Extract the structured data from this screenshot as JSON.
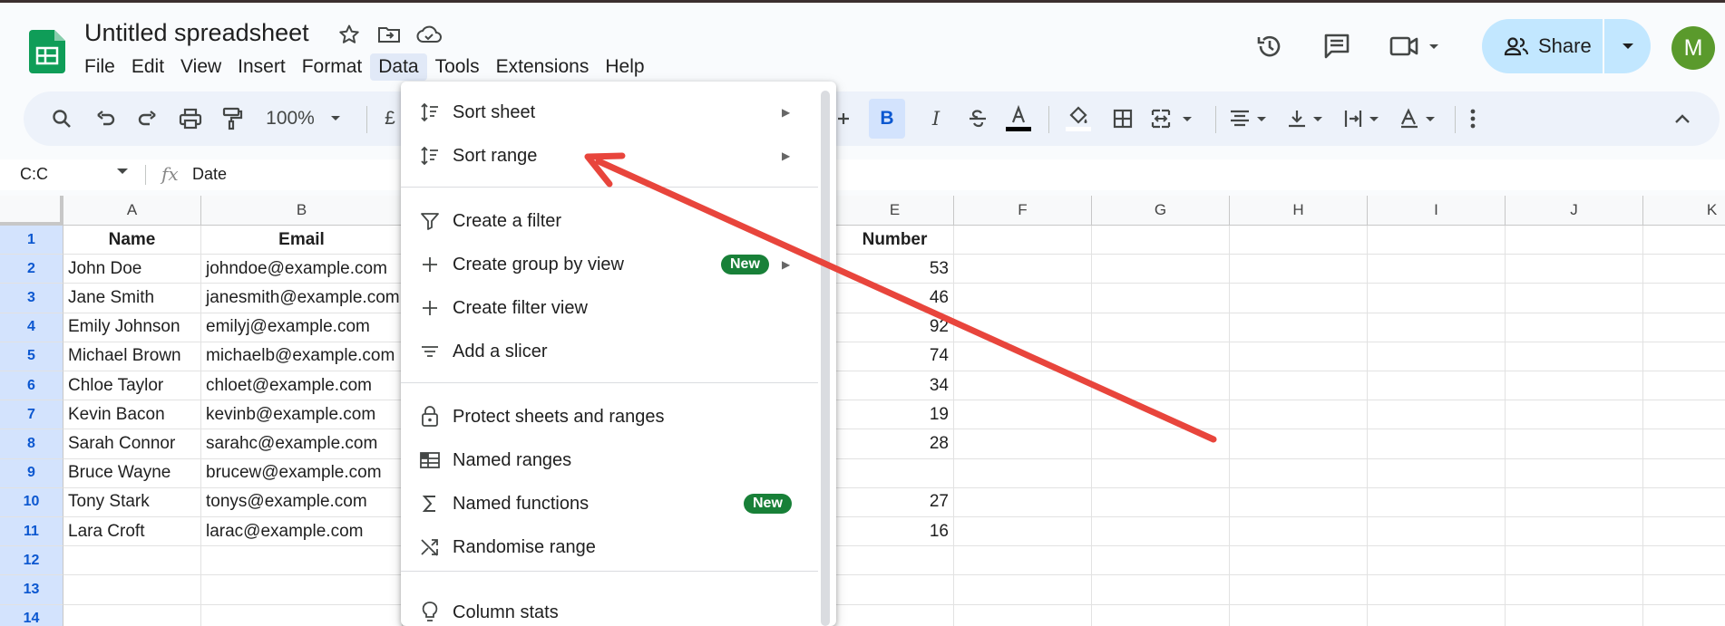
{
  "header": {
    "doc_title": "Untitled spreadsheet",
    "menu": [
      "File",
      "Edit",
      "View",
      "Insert",
      "Format",
      "Data",
      "Tools",
      "Extensions",
      "Help"
    ],
    "active_menu": "Data",
    "share_label": "Share",
    "avatar_initial": "M"
  },
  "toolbar": {
    "zoom": "100%",
    "currency": "£"
  },
  "formula_bar": {
    "namebox": "C:C",
    "fx": "fx",
    "content": "Date"
  },
  "columns": [
    "A",
    "B",
    "E",
    "F",
    "G",
    "H",
    "I",
    "J",
    "K"
  ],
  "row_numbers": [
    "1",
    "2",
    "3",
    "4",
    "5",
    "6",
    "7",
    "8",
    "9",
    "10",
    "11",
    "12",
    "13",
    "14"
  ],
  "table": {
    "headers": {
      "name": "Name",
      "email": "Email",
      "number": "Number"
    },
    "rows": [
      {
        "name": "John Doe",
        "email": "johndoe@example.com",
        "number": "53"
      },
      {
        "name": "Jane Smith",
        "email": "janesmith@example.com",
        "number": "46"
      },
      {
        "name": "Emily Johnson",
        "email": "emilyj@example.com",
        "number": "92"
      },
      {
        "name": "Michael Brown",
        "email": "michaelb@example.com",
        "number": "74"
      },
      {
        "name": "Chloe Taylor",
        "email": "chloet@example.com",
        "number": "34"
      },
      {
        "name": "Kevin Bacon",
        "email": "kevinb@example.com",
        "number": "19"
      },
      {
        "name": "Sarah Connor",
        "email": "sarahc@example.com",
        "number": "28"
      },
      {
        "name": "Bruce Wayne",
        "email": "brucew@example.com",
        "number": ""
      },
      {
        "name": "Tony Stark",
        "email": "tonys@example.com",
        "number": "27"
      },
      {
        "name": "Lara Croft",
        "email": "larac@example.com",
        "number": "16"
      }
    ]
  },
  "data_menu": {
    "items": [
      {
        "label": "Sort sheet",
        "icon": "sort-icon",
        "submenu": true
      },
      {
        "label": "Sort range",
        "icon": "sort-icon",
        "submenu": true
      },
      {
        "label": "Create a filter",
        "icon": "filter-icon"
      },
      {
        "label": "Create group by view",
        "icon": "plus-icon",
        "badge": "New",
        "submenu": true
      },
      {
        "label": "Create filter view",
        "icon": "plus-icon"
      },
      {
        "label": "Add a slicer",
        "icon": "slicer-icon"
      },
      {
        "label": "Protect sheets and ranges",
        "icon": "lock-icon"
      },
      {
        "label": "Named ranges",
        "icon": "named-ranges-icon"
      },
      {
        "label": "Named functions",
        "icon": "sigma-icon",
        "badge": "New"
      },
      {
        "label": "Randomise range",
        "icon": "shuffle-icon"
      },
      {
        "label": "Column stats",
        "icon": "lightbulb-icon"
      }
    ]
  },
  "colors": {
    "accent": "#0b57d0",
    "share_bg": "#c2e7ff",
    "badge_green": "#188038",
    "annotation_arrow": "#e8453c",
    "sheets_green": "#0f9d58"
  }
}
